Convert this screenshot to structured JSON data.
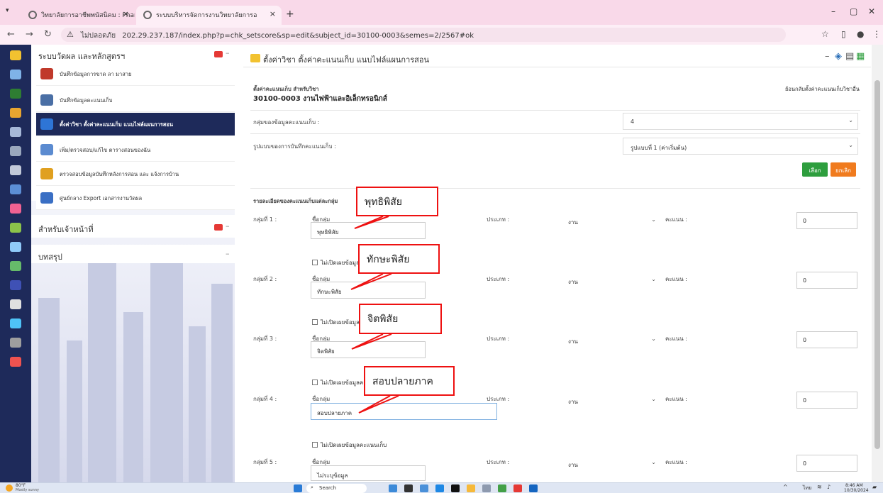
{
  "browser": {
    "tabs": [
      {
        "title": "วิทยาลัยการอาชีพพนัสนิคม : Phan"
      },
      {
        "title": "ระบบบริหารจัดการงานวิทยาลัยการอ"
      }
    ],
    "new_tab": "+",
    "address": {
      "security": "ไม่ปลอดภัย",
      "url": "202.29.237.187/index.php?p=chk_setscore&sp=edit&subject_id=30100-0003&semes=2/2567#ok"
    }
  },
  "sidebar": {
    "section1": "ระบบวัดผล และหลักสูตรฯ",
    "items": [
      {
        "label": "บันทึกข้อมูลการขาด ลา มาสาย",
        "color": "#c0392b"
      },
      {
        "label": "บันทึกข้อมูลคะแนนเก็บ",
        "color": "#4a6fa5"
      },
      {
        "label": "ตั้งค่าวิชา ตั้งค่าคะแนนเก็บ แนบไฟล์แผนการสอน",
        "color": "#2e75d6"
      },
      {
        "label": "เพิ่ม/ตรวจสอบ/แก้ไข ตารางสอนของฉัน",
        "color": "#5b8bd0"
      },
      {
        "label": "ตรวจสอบข้อมูลบันทึกหลังการสอน และ แจ้งการบ้าน",
        "color": "#e0a020"
      },
      {
        "label": "ศูนย์กลาง Export เอกสารงานวัดผล",
        "color": "#3a6fc4"
      }
    ],
    "section2": "สำหรับเจ้าหน้าที่",
    "section3": "บทสรุป"
  },
  "main": {
    "page_title": "ตั้งค่าวิชา ตั้งค่าคะแนนเก็บ แนบไฟล์แผนการสอน",
    "subject_caption": "ตั้งค่าคะแนนเก็บ สำหรับวิชา",
    "subject_name": "30100-0003 งานไฟฟ้าและอิเล็กทรอนิกส์",
    "back_link": "ย้อนกลับตั้งค่าคะแนนเก็บวิชาอื่น",
    "group_count_label": "กลุ่มของข้อมูลคะแนนเก็บ :",
    "group_count_value": "4",
    "format_label": "รูปแบบของการบันทึกคะแนนเก็บ :",
    "format_value": "รูปแบบที่ 1 (ค่าเริ่มต้น)",
    "select_button": "เลือก",
    "cancel_button": "ยกเลิก",
    "details_heading": "รายละเอียดของคะแนนเก็บแต่ละกลุ่ม",
    "name_label": "ชื่อกลุ่ม",
    "type_label": "ประเภท :",
    "score_label": "คะแนน :",
    "hide_label": "ไม่เปิดเผยข้อมูลคะแนนเก็บ",
    "groups": [
      {
        "label": "กลุ่มที่ 1 :",
        "name": "พุทธิพิสัย",
        "type": "งาน",
        "score": "0"
      },
      {
        "label": "กลุ่มที่ 2 :",
        "name": "ทักษะพิสัย",
        "type": "งาน",
        "score": "0"
      },
      {
        "label": "กลุ่มที่ 3 :",
        "name": "จิตพิสัย",
        "type": "งาน",
        "score": "0"
      },
      {
        "label": "กลุ่มที่ 4 :",
        "name": "สอบปลายภาค",
        "type": "งาน",
        "score": "0"
      },
      {
        "label": "กลุ่มที่ 5 :",
        "name": "ไม่ระบุข้อมูล",
        "type": "งาน",
        "score": "0"
      }
    ]
  },
  "callouts": [
    "พุทธิพิสัย",
    "ทักษะพิสัย",
    "จิตพิสัย",
    "สอบปลายภาค"
  ],
  "taskbar": {
    "weather_temp": "80°F",
    "weather_desc": "Mostly sunny",
    "search": "Search",
    "lang": "ไทย",
    "time": "8:46 AM",
    "date": "10/30/2024"
  },
  "colors": {
    "sidebar_dark": "#1e2a5a",
    "success": "#2e9e3e",
    "danger": "#f07b1e",
    "callout": "#e11111"
  }
}
